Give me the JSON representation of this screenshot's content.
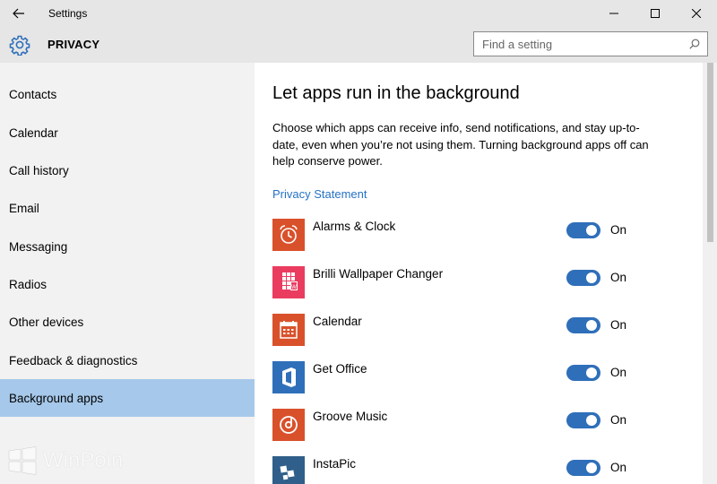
{
  "window": {
    "title": "Settings",
    "back_icon": "back-arrow-icon",
    "controls": [
      "minimize-icon",
      "maximize-icon",
      "close-icon"
    ]
  },
  "header": {
    "title": "PRIVACY",
    "icon": "gear-icon",
    "search_placeholder": "Find a setting",
    "search_icon": "search-icon"
  },
  "sidebar": {
    "items": [
      {
        "label": "Contacts"
      },
      {
        "label": "Calendar"
      },
      {
        "label": "Call history"
      },
      {
        "label": "Email"
      },
      {
        "label": "Messaging"
      },
      {
        "label": "Radios"
      },
      {
        "label": "Other devices"
      },
      {
        "label": "Feedback & diagnostics"
      },
      {
        "label": "Background apps"
      }
    ],
    "selected": "Background apps"
  },
  "watermark": {
    "text": "WinPoin"
  },
  "main": {
    "title": "Let apps run in the background",
    "description": "Choose which apps can receive info, send notifications, and stay up-to-date, even when you’re not using them. Turning background apps off can help conserve power.",
    "privacy_link": "Privacy Statement",
    "apps": [
      {
        "name": "Alarms & Clock",
        "state": "On",
        "icon": "alarm-clock-icon",
        "color": "#d9512b"
      },
      {
        "name": "Brilli Wallpaper Changer",
        "state": "On",
        "icon": "wallpaper-icon",
        "color": "#ea3c5f"
      },
      {
        "name": "Calendar",
        "state": "On",
        "icon": "calendar-icon",
        "color": "#d9512b"
      },
      {
        "name": "Get Office",
        "state": "On",
        "icon": "office-icon",
        "color": "#2f6fba"
      },
      {
        "name": "Groove Music",
        "state": "On",
        "icon": "groove-music-icon",
        "color": "#d9512b"
      },
      {
        "name": "InstaPic",
        "state": "On",
        "icon": "instapic-icon",
        "color": "#2f5f8a"
      }
    ]
  },
  "colors": {
    "accent": "#2f6fba",
    "selection": "#a6c8ea",
    "link": "#2672c5",
    "chrome": "#e6e6e6",
    "sidebar": "#f2f2f2"
  }
}
